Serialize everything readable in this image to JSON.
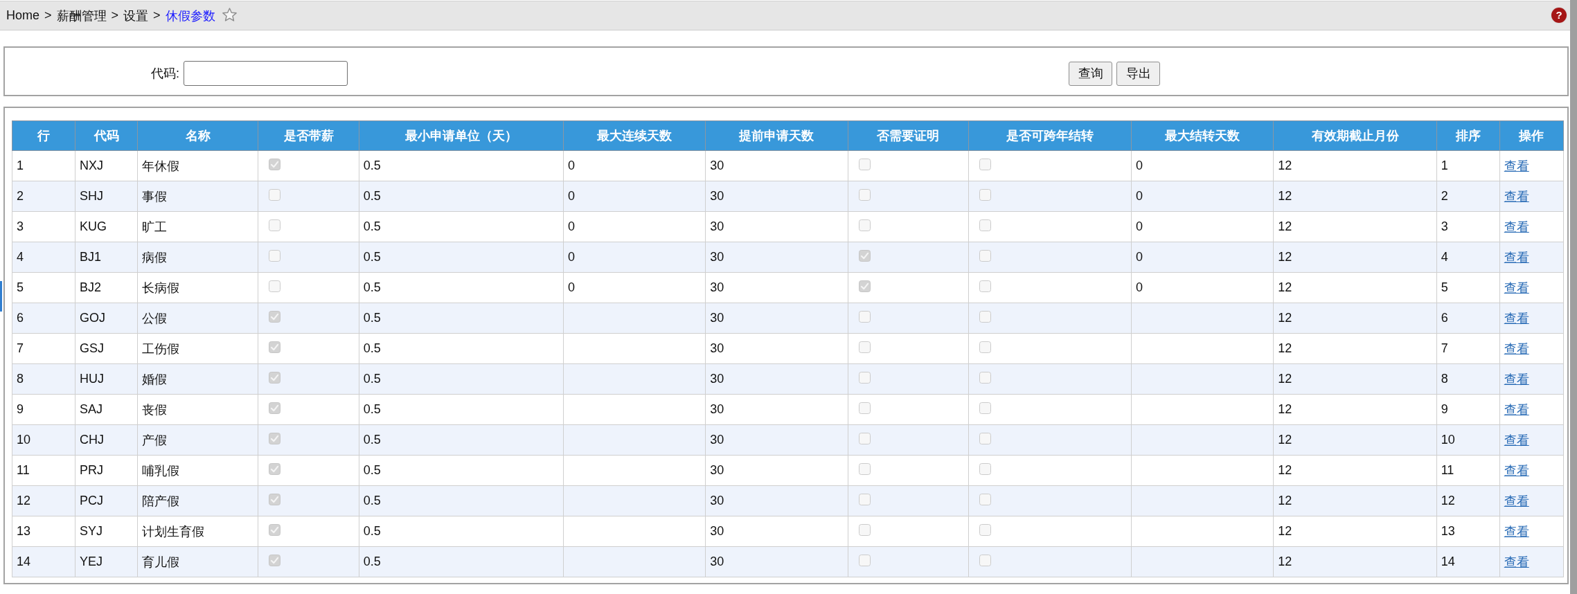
{
  "breadcrumb": [
    {
      "label": "Home",
      "current": false,
      "separator": ">"
    },
    {
      "label": "薪酬管理",
      "current": false,
      "separator": ">"
    },
    {
      "label": "设置",
      "current": false,
      "separator": ">"
    },
    {
      "label": "休假参数",
      "current": true
    }
  ],
  "help_button": {
    "label": "?"
  },
  "filter": {
    "fields": [
      {
        "label": "代码:"
      }
    ],
    "buttons": [
      "查询",
      "导出"
    ]
  },
  "table": {
    "columns": [
      "行",
      "代码",
      "名称",
      "是否带薪",
      "最小申请单位（天）",
      "最大连续天数",
      "提前申请天数",
      "否需要证明",
      "是否可跨年结转",
      "最大结转天数",
      "有效期截止月份",
      "排序",
      "操作"
    ],
    "rows": [
      {
        "no": "1",
        "code": "NXJ",
        "name": "年休假",
        "paid": true,
        "min_unit": "0.5",
        "max_consecutive_days": "0",
        "advance_days": "30",
        "proof_required": false,
        "carry_over": false,
        "max_carry_over_days": "0",
        "expiry_month": "12",
        "sort_order": "1",
        "action": "查看"
      },
      {
        "no": "2",
        "code": "SHJ",
        "name": "事假",
        "paid": false,
        "min_unit": "0.5",
        "max_consecutive_days": "0",
        "advance_days": "30",
        "proof_required": false,
        "carry_over": false,
        "max_carry_over_days": "0",
        "expiry_month": "12",
        "sort_order": "2",
        "action": "查看"
      },
      {
        "no": "3",
        "code": "KUG",
        "name": "旷工",
        "paid": false,
        "min_unit": "0.5",
        "max_consecutive_days": "0",
        "advance_days": "30",
        "proof_required": false,
        "carry_over": false,
        "max_carry_over_days": "0",
        "expiry_month": "12",
        "sort_order": "3",
        "action": "查看"
      },
      {
        "no": "4",
        "code": "BJ1",
        "name": "病假",
        "paid": false,
        "min_unit": "0.5",
        "max_consecutive_days": "0",
        "advance_days": "30",
        "proof_required": true,
        "carry_over": false,
        "max_carry_over_days": "0",
        "expiry_month": "12",
        "sort_order": "4",
        "action": "查看"
      },
      {
        "no": "5",
        "code": "BJ2",
        "name": "长病假",
        "paid": false,
        "min_unit": "0.5",
        "max_consecutive_days": "0",
        "advance_days": "30",
        "proof_required": true,
        "carry_over": false,
        "max_carry_over_days": "0",
        "expiry_month": "12",
        "sort_order": "5",
        "action": "查看"
      },
      {
        "no": "6",
        "code": "GOJ",
        "name": "公假",
        "paid": true,
        "min_unit": "0.5",
        "advance_days": "30",
        "proof_required": false,
        "carry_over": false,
        "expiry_month": "12",
        "sort_order": "6",
        "action": "查看"
      },
      {
        "no": "7",
        "code": "GSJ",
        "name": "工伤假",
        "paid": true,
        "min_unit": "0.5",
        "advance_days": "30",
        "proof_required": false,
        "carry_over": false,
        "expiry_month": "12",
        "sort_order": "7",
        "action": "查看"
      },
      {
        "no": "8",
        "code": "HUJ",
        "name": "婚假",
        "paid": true,
        "min_unit": "0.5",
        "advance_days": "30",
        "proof_required": false,
        "carry_over": false,
        "expiry_month": "12",
        "sort_order": "8",
        "action": "查看"
      },
      {
        "no": "9",
        "code": "SAJ",
        "name": "丧假",
        "paid": true,
        "min_unit": "0.5",
        "advance_days": "30",
        "proof_required": false,
        "carry_over": false,
        "expiry_month": "12",
        "sort_order": "9",
        "action": "查看"
      },
      {
        "no": "10",
        "code": "CHJ",
        "name": "产假",
        "paid": true,
        "min_unit": "0.5",
        "advance_days": "30",
        "proof_required": false,
        "carry_over": false,
        "expiry_month": "12",
        "sort_order": "10",
        "action": "查看"
      },
      {
        "no": "11",
        "code": "PRJ",
        "name": "哺乳假",
        "paid": true,
        "min_unit": "0.5",
        "advance_days": "30",
        "proof_required": false,
        "carry_over": false,
        "expiry_month": "12",
        "sort_order": "11",
        "action": "查看"
      },
      {
        "no": "12",
        "code": "PCJ",
        "name": "陪产假",
        "paid": true,
        "min_unit": "0.5",
        "advance_days": "30",
        "proof_required": false,
        "carry_over": false,
        "expiry_month": "12",
        "sort_order": "12",
        "action": "查看"
      },
      {
        "no": "13",
        "code": "SYJ",
        "name": "计划生育假",
        "paid": true,
        "min_unit": "0.5",
        "advance_days": "30",
        "proof_required": false,
        "carry_over": false,
        "expiry_month": "12",
        "sort_order": "13",
        "action": "查看"
      },
      {
        "no": "14",
        "code": "YEJ",
        "name": "育儿假",
        "paid": true,
        "min_unit": "0.5",
        "advance_days": "30",
        "proof_required": false,
        "carry_over": false,
        "expiry_month": "12",
        "sort_order": "14",
        "action": "查看"
      }
    ]
  }
}
